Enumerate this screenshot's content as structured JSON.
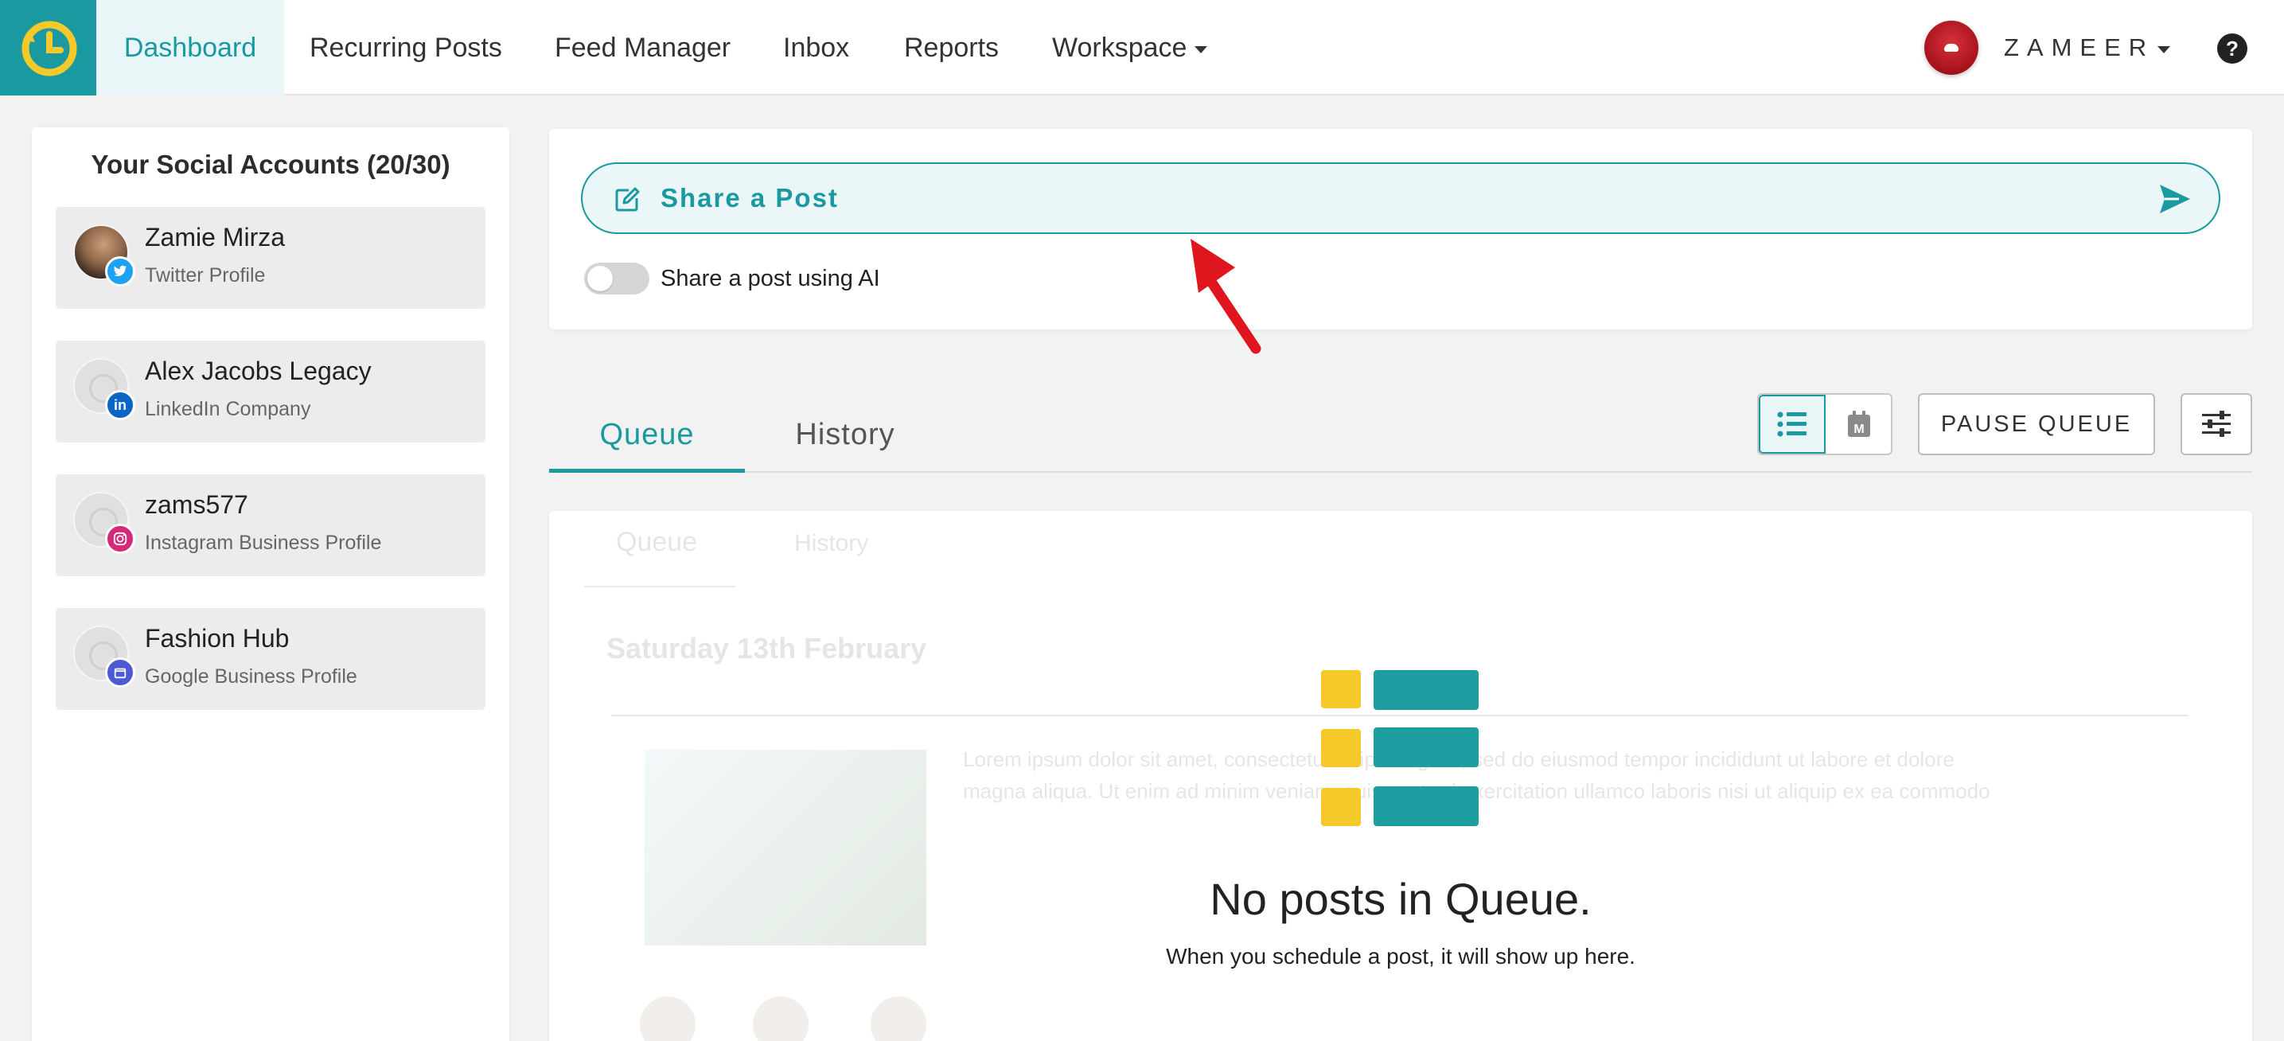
{
  "nav": {
    "items": [
      {
        "label": "Dashboard",
        "active": true
      },
      {
        "label": "Recurring Posts"
      },
      {
        "label": "Feed Manager"
      },
      {
        "label": "Inbox"
      },
      {
        "label": "Reports"
      },
      {
        "label": "Workspace"
      }
    ],
    "user": "ZAMEER",
    "help": "?"
  },
  "sidebar": {
    "title": "Your Social Accounts (20/30)",
    "accounts": [
      {
        "name": "Zamie Mirza",
        "type": "Twitter Profile",
        "network": "twitter",
        "color": "#1da1f2"
      },
      {
        "name": "Alex Jacobs Legacy",
        "type": "LinkedIn Company",
        "network": "linkedin",
        "color": "#0a66c2"
      },
      {
        "name": "zams577",
        "type": "Instagram Business Profile",
        "network": "instagram",
        "color": "#d6297a"
      },
      {
        "name": "Fashion Hub",
        "type": "Google Business Profile",
        "network": "google-business",
        "color": "#4c5bd4"
      }
    ]
  },
  "share": {
    "label": "Share a Post",
    "ai_label": "Share a post using AI",
    "ai_enabled": false
  },
  "tabs": {
    "queue": "Queue",
    "history": "History",
    "active": "Queue"
  },
  "toolbar": {
    "pause_label": "PAUSE QUEUE",
    "calendar_letter": "M"
  },
  "queue": {
    "empty_title": "No posts in Queue.",
    "empty_subtitle": "When you schedule a post, it will show up here.",
    "ghost": {
      "tab_queue": "Queue",
      "tab_history": "History",
      "date": "Saturday 13th February",
      "text_line1": "Lorem ipsum dolor sit amet, consectetur adipiscing elit, sed do eiusmod tempor incididunt ut labore et dolore",
      "text_line2": "magna aliqua. Ut enim ad minim veniam, quis nostrud exercitation ullamco laboris nisi ut aliquip ex ea commodo"
    }
  },
  "colors": {
    "brand": "#1a9aa0",
    "accent_yellow": "#f6c92b",
    "annotation_red": "#e0161e"
  }
}
